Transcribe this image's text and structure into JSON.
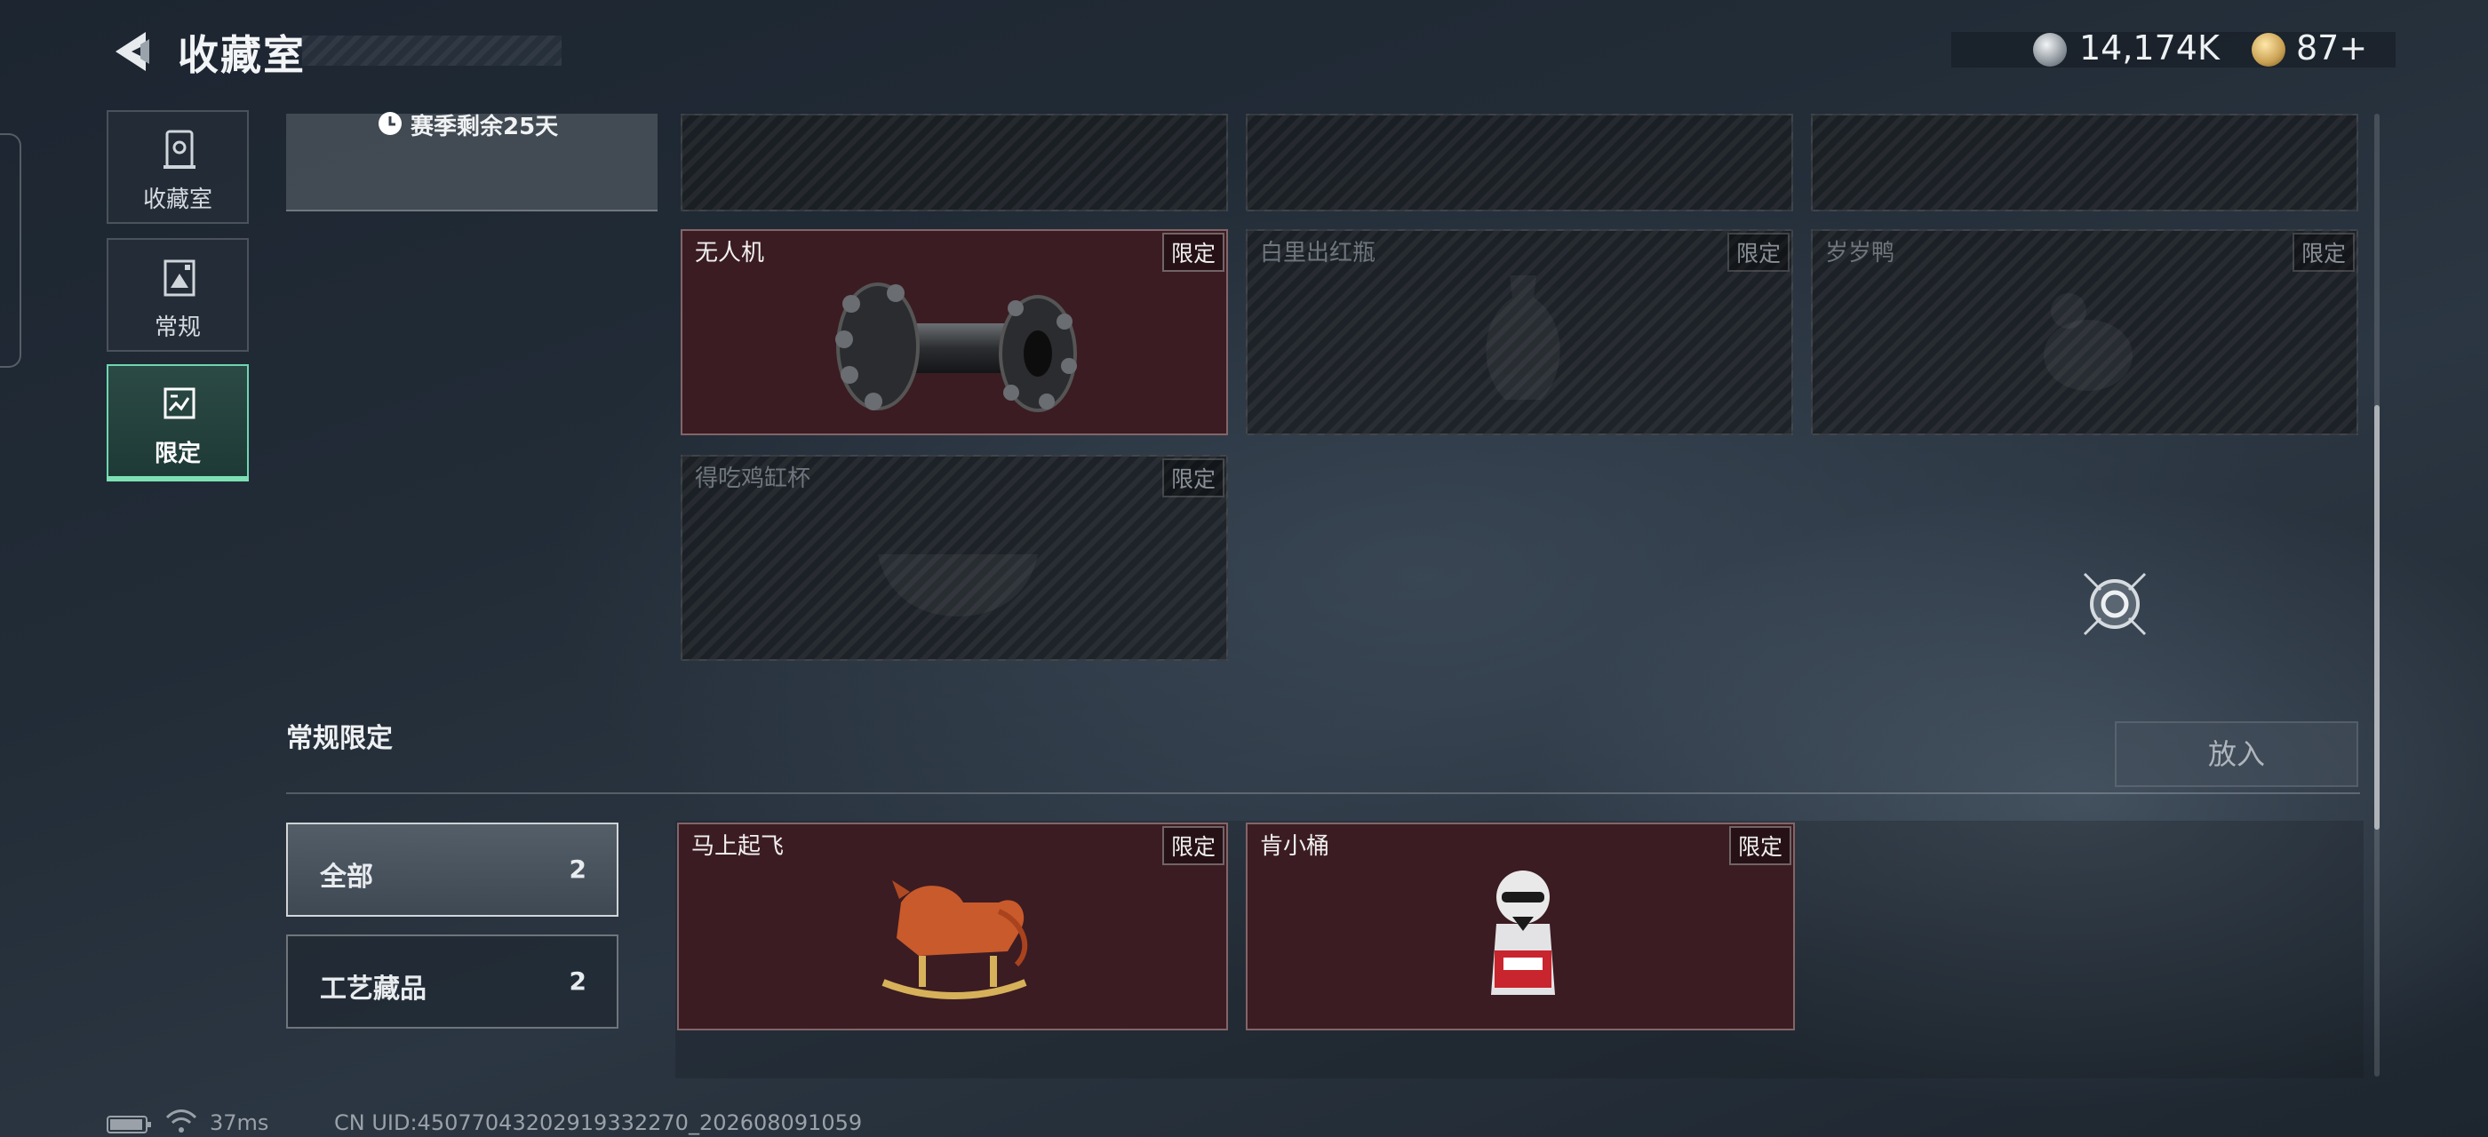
{
  "header": {
    "title": "收藏室",
    "currency_silver": "14,174K",
    "currency_gold": "87+"
  },
  "nav": {
    "items": [
      {
        "label": "收藏室",
        "icon": "collection-room-icon"
      },
      {
        "label": "常规",
        "icon": "regular-icon"
      },
      {
        "label": "限定",
        "icon": "limited-icon"
      }
    ]
  },
  "season": {
    "text": "赛季剩余25天"
  },
  "grid": {
    "items": [
      {
        "name": "无人机",
        "tag": "限定",
        "owned": true
      },
      {
        "name": "白里出红瓶",
        "tag": "限定",
        "owned": false
      },
      {
        "name": "岁岁鸭",
        "tag": "限定",
        "owned": false
      },
      {
        "name": "得吃鸡缸杯",
        "tag": "限定",
        "owned": false
      }
    ]
  },
  "section": {
    "title": "常规限定",
    "place_button": "放入"
  },
  "filters": [
    {
      "label": "全部",
      "count": "2"
    },
    {
      "label": "工艺藏品",
      "count": "2"
    }
  ],
  "section_items": [
    {
      "name": "马上起飞",
      "tag": "限定"
    },
    {
      "name": "肯小桶",
      "tag": "限定"
    }
  ],
  "status": {
    "ping": "37ms",
    "uid": "CN UID:4507704320291933227​0_202608091059"
  },
  "colors": {
    "accent": "#7de0b5",
    "owned_cell": "#3b1c22"
  }
}
